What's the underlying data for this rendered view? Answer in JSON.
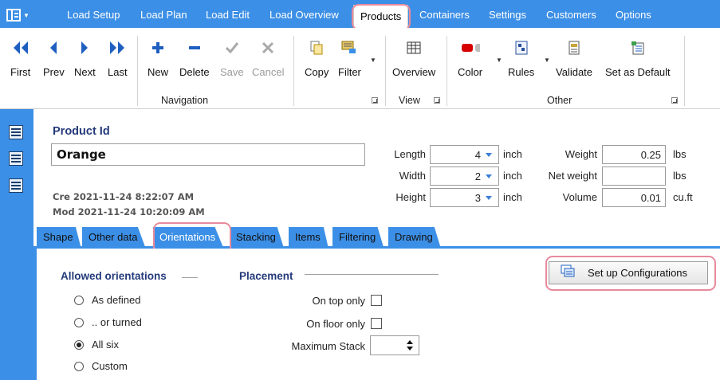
{
  "ribbon_tabs": [
    {
      "label": "Load Setup"
    },
    {
      "label": "Load Plan"
    },
    {
      "label": "Load Edit"
    },
    {
      "label": "Load Overview"
    },
    {
      "label": "Products"
    },
    {
      "label": "Containers"
    },
    {
      "label": "Settings"
    },
    {
      "label": "Customers"
    },
    {
      "label": "Options"
    }
  ],
  "ribbon": {
    "navigation": {
      "group_label": "Navigation",
      "buttons": [
        {
          "label": "First",
          "icon": "double-left-arrow-icon"
        },
        {
          "label": "Prev",
          "icon": "left-arrow-icon"
        },
        {
          "label": "Next",
          "icon": "right-arrow-icon"
        },
        {
          "label": "Last",
          "icon": "double-right-arrow-icon"
        },
        {
          "label": "New",
          "icon": "plus-icon"
        },
        {
          "label": "Delete",
          "icon": "minus-icon"
        },
        {
          "label": "Save",
          "icon": "checkmark-icon",
          "disabled": true
        },
        {
          "label": "Cancel",
          "icon": "x-icon",
          "disabled": true
        },
        {
          "label": "Copy",
          "icon": "copy-icon"
        },
        {
          "label": "Filter",
          "icon": "filter-icon"
        }
      ]
    },
    "view": {
      "group_label": "View",
      "buttons": [
        {
          "label": "Overview",
          "icon": "grid-icon"
        }
      ]
    },
    "other": {
      "group_label": "Other",
      "buttons": [
        {
          "label": "Color",
          "icon": "color-icon"
        },
        {
          "label": "Rules",
          "icon": "rules-icon"
        },
        {
          "label": "Validate",
          "icon": "validate-icon"
        },
        {
          "label": "Set as Default",
          "icon": "set-default-icon"
        }
      ]
    }
  },
  "product": {
    "id_label": "Product Id",
    "id_value": "Orange",
    "created": "Cre 2021-11-24 8:22:07 AM",
    "modified": "Mod 2021-11-24 10:20:09 AM",
    "dimensions": [
      {
        "label": "Length",
        "value": "4",
        "unit": "inch"
      },
      {
        "label": "Width",
        "value": "2",
        "unit": "inch"
      },
      {
        "label": "Height",
        "value": "3",
        "unit": "inch"
      }
    ],
    "weights": [
      {
        "label": "Weight",
        "value": "0.25",
        "unit": "lbs"
      },
      {
        "label": "Net weight",
        "value": "",
        "unit": "lbs"
      },
      {
        "label": "Volume",
        "value": "0.01",
        "unit": "cu.ft"
      }
    ]
  },
  "sub_tabs": [
    {
      "label": "Shape"
    },
    {
      "label": "Other data"
    },
    {
      "label": "Orientations",
      "active": true
    },
    {
      "label": "Stacking"
    },
    {
      "label": "Items"
    },
    {
      "label": "Filtering"
    },
    {
      "label": "Drawing"
    }
  ],
  "orientations": {
    "allowed_header": "Allowed orientations",
    "options": [
      {
        "label": "As defined",
        "selected": false
      },
      {
        "label": ".. or turned",
        "selected": false
      },
      {
        "label": "All six",
        "selected": true
      },
      {
        "label": "Custom",
        "selected": false
      }
    ],
    "placement_header": "Placement",
    "on_top_only": "On top only",
    "on_floor_only": "On floor only",
    "maximum_stack": "Maximum Stack",
    "setup_button": "Set up Configurations"
  },
  "colors": {
    "accent": "#3c8fe6",
    "highlight": "#e88a9c",
    "header_text": "#243a7a"
  }
}
